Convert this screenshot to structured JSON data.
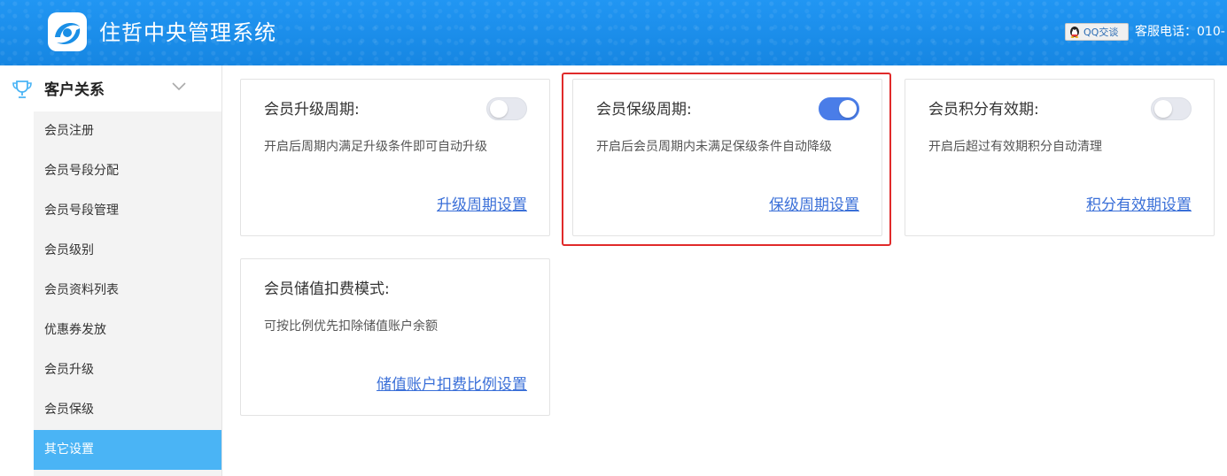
{
  "header": {
    "app_title": "住哲中央管理系统",
    "qq_label": "QQ交谈",
    "service_phone": "客服电话：010-"
  },
  "sidebar": {
    "section_label": "客户关系",
    "items": [
      {
        "label": "会员注册"
      },
      {
        "label": "会员号段分配"
      },
      {
        "label": "会员号段管理"
      },
      {
        "label": "会员级别"
      },
      {
        "label": "会员资料列表"
      },
      {
        "label": "优惠券发放"
      },
      {
        "label": "会员升级"
      },
      {
        "label": "会员保级"
      },
      {
        "label": "其它设置",
        "active": true
      }
    ]
  },
  "cards": [
    {
      "title": "会员升级周期:",
      "desc": "开启后周期内满足升级条件即可自动升级",
      "link": "升级周期设置",
      "toggle": "off"
    },
    {
      "title": "会员保级周期:",
      "desc": "开启后会员周期内未满足保级条件自动降级",
      "link": "保级周期设置",
      "toggle": "on"
    },
    {
      "title": "会员积分有效期:",
      "desc": "开启后超过有效期积分自动清理",
      "link": "积分有效期设置",
      "toggle": "off"
    },
    {
      "title": "会员储值扣费模式:",
      "desc": "可按比例优先扣除储值账户余额",
      "link": "储值账户扣费比例设置"
    }
  ],
  "colors": {
    "header_blue": "#1a8fe6",
    "active_menu": "#4ab4f5",
    "toggle_on": "#4a7de8",
    "link": "#3a6fd8",
    "highlight_red": "#e02a2a"
  }
}
